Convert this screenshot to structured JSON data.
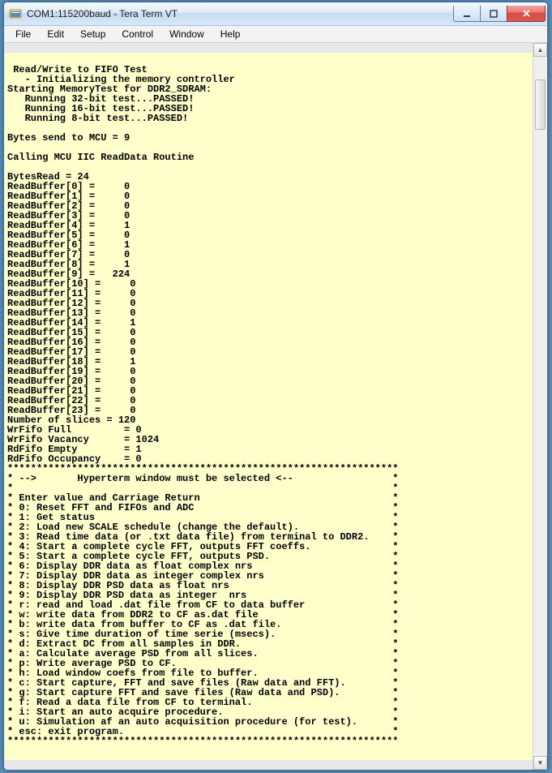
{
  "window": {
    "title": "COM1:115200baud - Tera Term VT"
  },
  "menu": {
    "items": [
      "File",
      "Edit",
      "Setup",
      "Control",
      "Window",
      "Help"
    ]
  },
  "terminal": {
    "intro": [
      "",
      " Read/Write to FIFO Test",
      "   - Initializing the memory controller",
      "Starting MemoryTest for DDR2_SDRAM:",
      "   Running 32-bit test...PASSED!",
      "   Running 16-bit test...PASSED!",
      "   Running 8-bit test...PASSED!",
      "",
      "Bytes send to MCU = 9",
      "",
      "Calling MCU IIC ReadData Routine",
      "",
      "BytesRead = 24"
    ],
    "readbuffer": [
      0,
      0,
      0,
      0,
      1,
      0,
      1,
      0,
      1,
      224,
      0,
      0,
      0,
      0,
      1,
      0,
      0,
      0,
      1,
      0,
      0,
      0,
      0,
      0
    ],
    "afterbuf": [
      "Number of slices = 120",
      "WrFifo Full         = 0",
      "WrFifo Vacancy      = 1024",
      "RdFifo Empty        = 1",
      "RdFifo Occupancy    = 0"
    ],
    "menu_header": "* -->       Hyperterm window must be selected <--",
    "menu_pre": "* Enter value and Carriage Return",
    "options": [
      "0: Reset FFT and FIFOs and ADC",
      "1: Get status",
      "2: Load new SCALE schedule (change the default).",
      "3: Read time data (or .txt data file) from terminal to DDR2.",
      "4: Start a complete cycle FFT, outputs FFT coeffs.",
      "5: Start a complete cycle FFT, outputs PSD.",
      "6: Display DDR data as float complex nrs",
      "7: Display DDR data as integer complex nrs",
      "8: Display DDR PSD data as float nrs",
      "9: Display DDR PSD data as integer  nrs",
      "r: read and load .dat file from CF to data buffer",
      "w: write data from DDR2 to CF as.dat file",
      "b: write data from buffer to CF as .dat file.",
      "s: Give time duration of time serie (msecs).",
      "d: Extract DC from all samples in DDR.",
      "a: Calculate average PSD from all slices.",
      "p: Write average PSD to CF.",
      "h: Load window coefs from file to buffer.",
      "c: Start capture, FFT and save files (Raw data and FFT).",
      "g: Start capture FFT and save files (Raw data and PSD).",
      "f: Read a data file from CF to terminal.",
      "i: Start an auto acquire procedure.",
      "u: Simulation af an auto acquisition procedure (for test).",
      "esc: exit program."
    ]
  }
}
